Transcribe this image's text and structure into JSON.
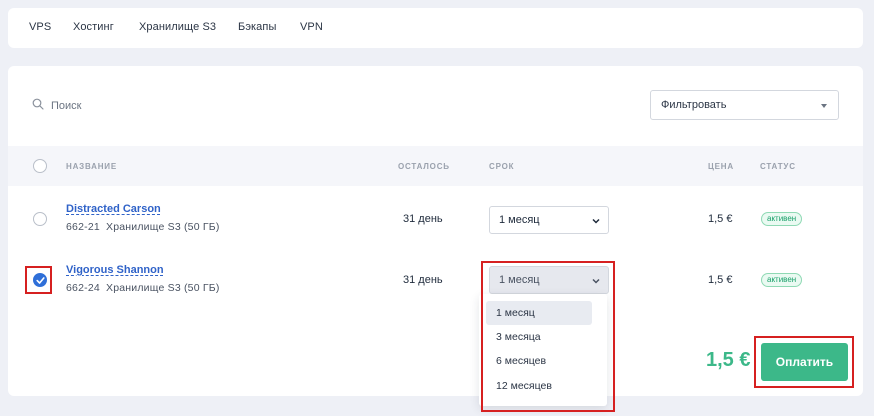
{
  "nav": {
    "tabs": [
      "VPS",
      "Хостинг",
      "Хранилище S3",
      "Бэкапы",
      "VPN"
    ]
  },
  "toolbar": {
    "search_placeholder": "Поиск",
    "filter_label": "Фильтровать"
  },
  "table": {
    "headers": {
      "name": "НАЗВАНИЕ",
      "remaining": "ОСТАЛОСЬ",
      "term": "СРОК",
      "price": "ЦЕНА",
      "status": "СТАТУС"
    },
    "rows": [
      {
        "name": "Distracted Carson",
        "id": "662-21",
        "description": "Хранилище S3 (50 ГБ)",
        "remaining": "31 день",
        "term": "1 месяц",
        "price": "1,5 €",
        "status": "активен",
        "selected": false
      },
      {
        "name": "Vigorous Shannon",
        "id": "662-24",
        "description": "Хранилище S3 (50 ГБ)",
        "remaining": "31 день",
        "term": "1 месяц",
        "price": "1,5 €",
        "status": "активен",
        "selected": true
      }
    ]
  },
  "term_dropdown": {
    "options": [
      "1 месяц",
      "3 месяца",
      "6 месяцев",
      "12 месяцев"
    ],
    "active": "1 месяц"
  },
  "footer": {
    "total": "1,5 €",
    "pay_label": "Оплатить"
  },
  "colors": {
    "accent_green": "#3cb889",
    "link_blue": "#2f62c8",
    "checkbox_blue": "#2f6fd8",
    "highlight_red": "#d62020"
  }
}
